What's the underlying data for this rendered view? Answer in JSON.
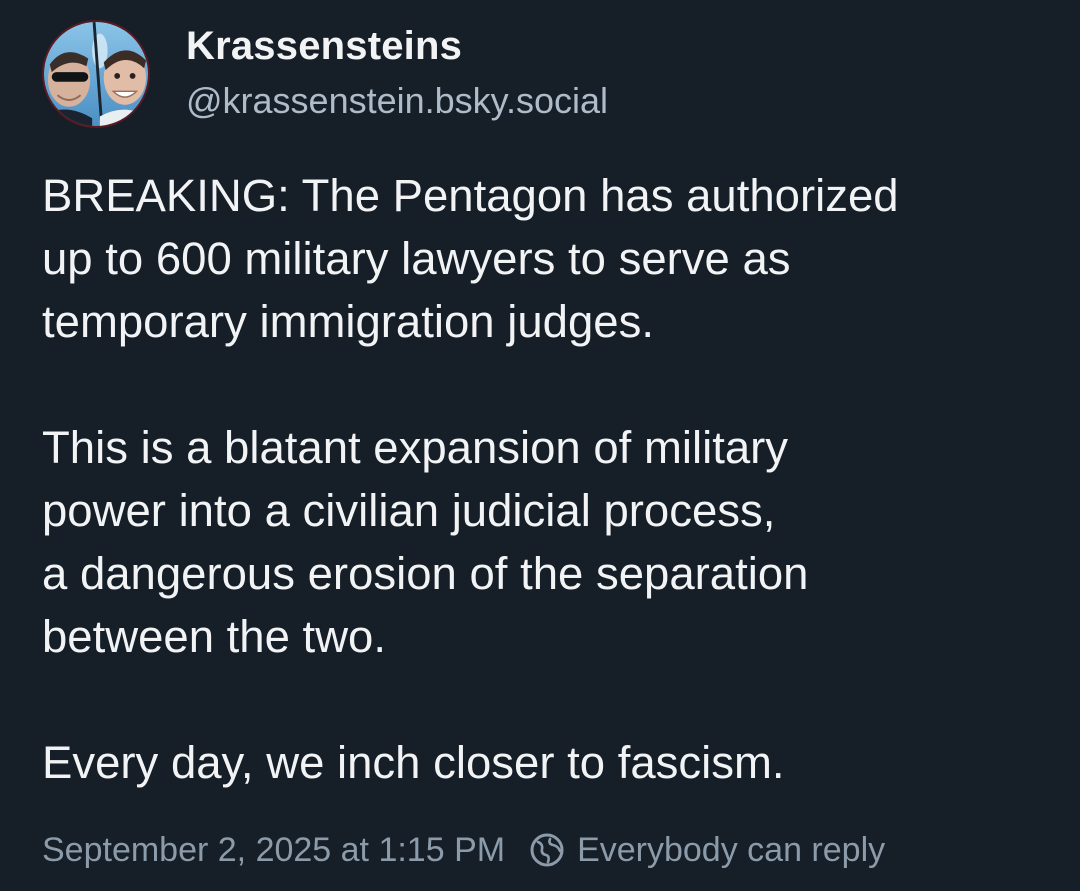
{
  "post": {
    "author": {
      "display_name": "Krassensteins",
      "handle": "@krassenstein.bsky.social"
    },
    "body": {
      "p1": "BREAKING: The Pentagon has authorized\nup to 600 military lawyers to serve as\ntemporary immigration judges.",
      "p2": "This is a blatant expansion of military\npower into a civilian judicial process,\na dangerous erosion of the separation\nbetween the two.",
      "p3": "Every day, we inch closer to fascism."
    },
    "meta": {
      "timestamp": "September 2, 2025 at 1:15 PM",
      "reply_setting": "Everybody can reply",
      "reply_icon": "globe-icon"
    }
  },
  "colors": {
    "background": "#161e27",
    "text_primary": "#f1f3f5",
    "text_secondary": "#aebbc9",
    "text_muted": "#8c9baa"
  }
}
